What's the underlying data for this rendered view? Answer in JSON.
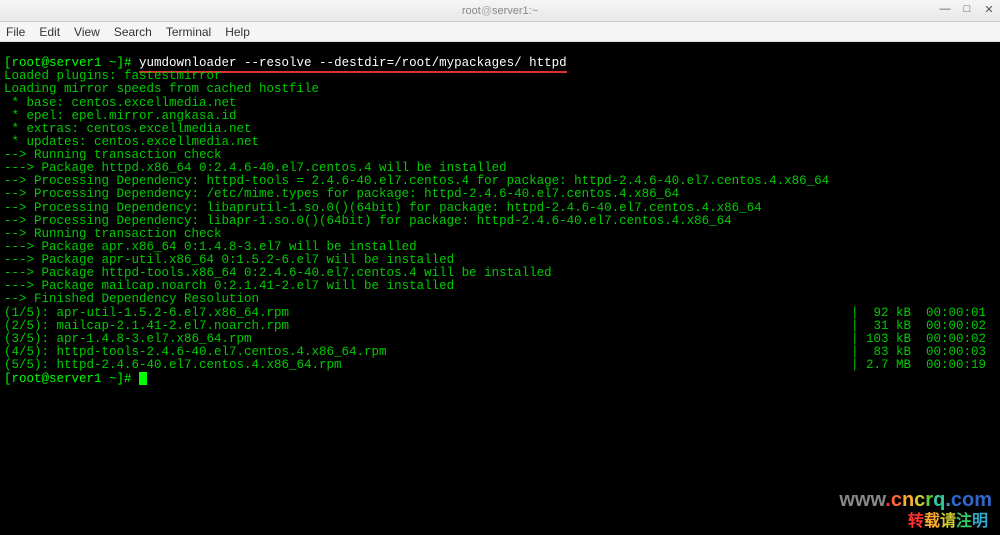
{
  "window": {
    "title_user": "root",
    "title_at": "@",
    "title_host": "server1:~"
  },
  "menu": {
    "file": "File",
    "edit": "Edit",
    "view": "View",
    "search": "Search",
    "terminal": "Terminal",
    "help": "Help"
  },
  "term": {
    "prompt1": "[root@server1 ~]# ",
    "command": "yumdownloader --resolve --destdir=/root/mypackages/ httpd",
    "l1": "Loaded plugins: fastestmirror",
    "l2": "Loading mirror speeds from cached hostfile",
    "l3": " * base: centos.excellmedia.net",
    "l4": " * epel: epel.mirror.angkasa.id",
    "l5": " * extras: centos.excellmedia.net",
    "l6": " * updates: centos.excellmedia.net",
    "l7": "--> Running transaction check",
    "l8": "---> Package httpd.x86_64 0:2.4.6-40.el7.centos.4 will be installed",
    "l9": "--> Processing Dependency: httpd-tools = 2.4.6-40.el7.centos.4 for package: httpd-2.4.6-40.el7.centos.4.x86_64",
    "l10": "--> Processing Dependency: /etc/mime.types for package: httpd-2.4.6-40.el7.centos.4.x86_64",
    "l11": "--> Processing Dependency: libaprutil-1.so.0()(64bit) for package: httpd-2.4.6-40.el7.centos.4.x86_64",
    "l12": "--> Processing Dependency: libapr-1.so.0()(64bit) for package: httpd-2.4.6-40.el7.centos.4.x86_64",
    "l13": "--> Running transaction check",
    "l14": "---> Package apr.x86_64 0:1.4.8-3.el7 will be installed",
    "l15": "---> Package apr-util.x86_64 0:1.5.2-6.el7 will be installed",
    "l16": "---> Package httpd-tools.x86_64 0:2.4.6-40.el7.centos.4 will be installed",
    "l17": "---> Package mailcap.noarch 0:2.1.41-2.el7 will be installed",
    "l18": "--> Finished Dependency Resolution",
    "d1_left": "(1/5): apr-util-1.5.2-6.el7.x86_64.rpm",
    "d1_right": "|  92 kB  00:00:01",
    "d2_left": "(2/5): mailcap-2.1.41-2.el7.noarch.rpm",
    "d2_right": "|  31 kB  00:00:02",
    "d3_left": "(3/5): apr-1.4.8-3.el7.x86_64.rpm",
    "d3_right": "| 103 kB  00:00:02",
    "d4_left": "(4/5): httpd-tools-2.4.6-40.el7.centos.4.x86_64.rpm",
    "d4_right": "|  83 kB  00:00:03",
    "d5_left": "(5/5): httpd-2.4.6-40.el7.centos.4.x86_64.rpm",
    "d5_right": "| 2.7 MB  00:00:19",
    "prompt2": "[root@server1 ~]# "
  },
  "watermark": {
    "url_w": "w",
    "url_ww": "ww",
    "url_dot1": ".",
    "url_c": "c",
    "url_n": "n",
    "url_c2": "c",
    "url_r": "r",
    "url_q": "q",
    "url_dot2": ".",
    "url_com": "com",
    "ch1": "转",
    "ch2": "载",
    "ch3": "请",
    "ch4": "注",
    "ch5": "明"
  }
}
